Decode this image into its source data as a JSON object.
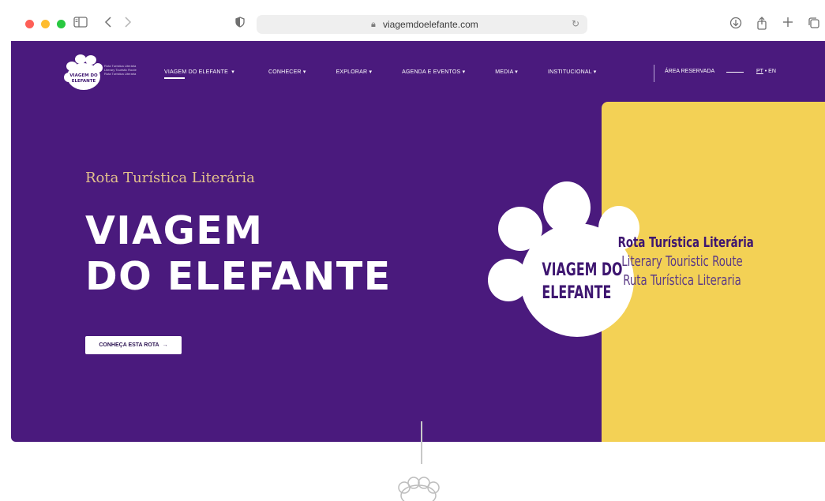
{
  "browser": {
    "url": "viagemdoelefante.com",
    "traffic_lights": [
      "#fe5f57",
      "#febc2e",
      "#28c840"
    ],
    "icons": [
      "sidebar-icon",
      "back-icon",
      "forward-icon",
      "shield-icon",
      "lock-icon",
      "reload-icon",
      "download-icon",
      "share-icon",
      "new-tab-icon",
      "tabs-icon"
    ]
  },
  "site": {
    "logo": {
      "text_line1": "VIAGEM DO",
      "text_line2": "ELEFANTE",
      "small_lines": [
        "Rota Turística Literária",
        "Literary Touristic Route",
        "Ruta Turística Literaria"
      ]
    },
    "nav": [
      {
        "label": "VIAGEM DO ELEFANTE",
        "active": true
      },
      {
        "label": "CONHECER",
        "active": false
      },
      {
        "label": "EXPLORAR",
        "active": false
      },
      {
        "label": "AGENDA E EVENTOS",
        "active": false
      },
      {
        "label": "MEDIA",
        "active": false
      },
      {
        "label": "INSTITUCIONAL",
        "active": false
      }
    ],
    "area_reservada": "ÁREA RESERVADA",
    "lang": {
      "pt": "PT",
      "en": "EN"
    }
  },
  "hero": {
    "subtitle": "Rota Turística Literária",
    "title_line1": "VIAGEM",
    "title_line2": "DO ELEFANTE",
    "cta": "CONHEÇA ESTA ROTA",
    "paw_line1": "VIAGEM DO",
    "paw_line2": "ELEFANTE",
    "tagline_pt": "Rota Turística Literária",
    "tagline_en": "Literary Touristic Route",
    "tagline_es": "Ruta Turística Literaria"
  },
  "colors": {
    "purple": "#4a1a7d",
    "yellow": "#f3d155",
    "gold_text": "#e3c18c"
  }
}
